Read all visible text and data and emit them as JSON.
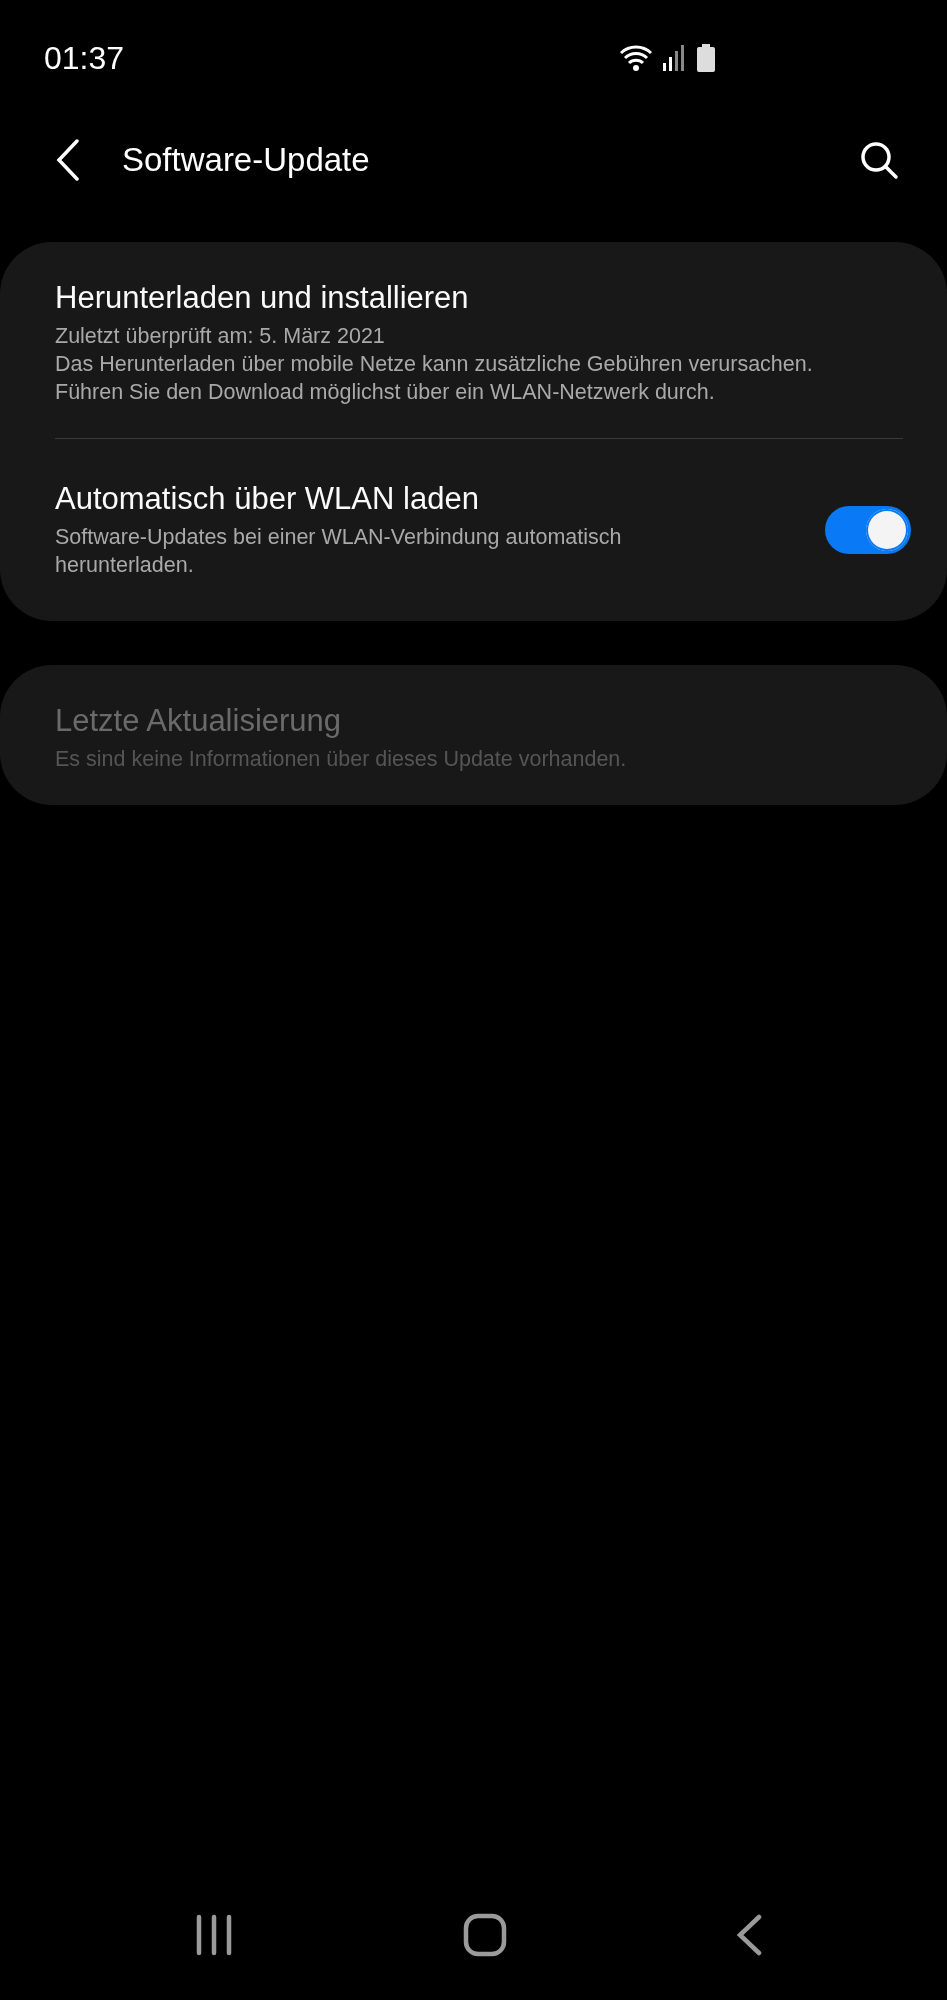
{
  "status_bar": {
    "time": "01:37"
  },
  "header": {
    "title": "Software-Update"
  },
  "cards": [
    {
      "disabled": false,
      "items": [
        {
          "kind": "info",
          "title": "Herunterladen und installieren",
          "lines": [
            "Zuletzt überprüft am: 5. März 2021",
            "Das Herunterladen über mobile Netze kann zusätzliche Gebühren verursachen.",
            "Führen Sie den Download möglichst über ein WLAN-Netzwerk durch."
          ]
        },
        {
          "kind": "toggle",
          "title": "Automatisch über WLAN laden",
          "lines": [
            "Software-Updates bei einer WLAN-Verbindung automatisch",
            "herunterladen."
          ],
          "on": true
        }
      ]
    },
    {
      "disabled": true,
      "items": [
        {
          "kind": "info",
          "title": "Letzte Aktualisierung",
          "lines": [
            "Es sind keine Informationen über dieses Update vorhanden."
          ]
        }
      ]
    }
  ]
}
